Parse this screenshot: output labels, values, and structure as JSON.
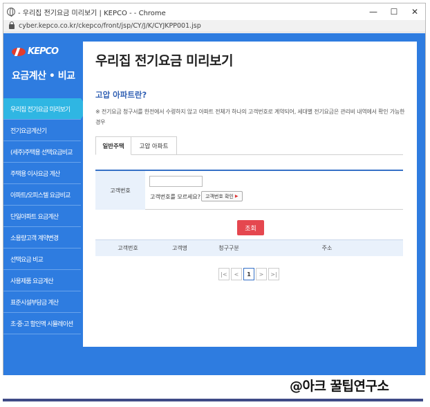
{
  "window": {
    "title": "- 우리집 전기요금 미리보기 | KEPCO - - Chrome",
    "url": "cyber.kepco.co.kr/ckepco/front/jsp/CY/J/K/CYJKPP001.jsp"
  },
  "sidebar": {
    "logo_text": "KEPCO",
    "title": "요금계산 • 비교",
    "items": [
      {
        "label": "우리집 전기요금 미리보기"
      },
      {
        "label": "전기요금계산기"
      },
      {
        "label": "(세주)주택용 선택요금비교"
      },
      {
        "label": "주택용 이사요금 계산"
      },
      {
        "label": "아파트/오피스텔 요금비교"
      },
      {
        "label": "단일아파트 요금계산"
      },
      {
        "label": "소용량고객 계약변경"
      },
      {
        "label": "선택요금 비교"
      },
      {
        "label": "사용제품 요금계산"
      },
      {
        "label": "표준시설부담금 계산"
      },
      {
        "label": "초·중·고 할인액 시뮬레이션"
      }
    ]
  },
  "main": {
    "page_title": "우리집 전기요금 미리보기",
    "section_title": "고압 아파트란?",
    "description": "※ 전기요금 청구서를 한전에서 수령하지 않고 아파트 전체가 하나의 고객번호로 계약되어, 세대별 전기요금은 관리비 내역에서 확인 가능한 경우",
    "tabs": [
      {
        "label": "일반주택"
      },
      {
        "label": "고압 아파트"
      }
    ],
    "form": {
      "label": "고객번호",
      "input_value": "",
      "help_text": "고객번호를 모르세요?",
      "help_button": "고객번호 확인"
    },
    "search_button": "조회",
    "table": {
      "headers": [
        "고객번호",
        "고객명",
        "청구구분",
        "주소"
      ]
    },
    "pager": {
      "first": "|<",
      "prev": "<",
      "current": "1",
      "next": ">",
      "last": ">|"
    }
  },
  "watermark": "@아크 꿀팁연구소",
  "colors": {
    "sidebar_bg": "#2e7ce0",
    "active_item": "#2fb6e3",
    "accent": "#3570c6",
    "search_button": "#e5474f",
    "brand_red": "#e23c2c"
  }
}
